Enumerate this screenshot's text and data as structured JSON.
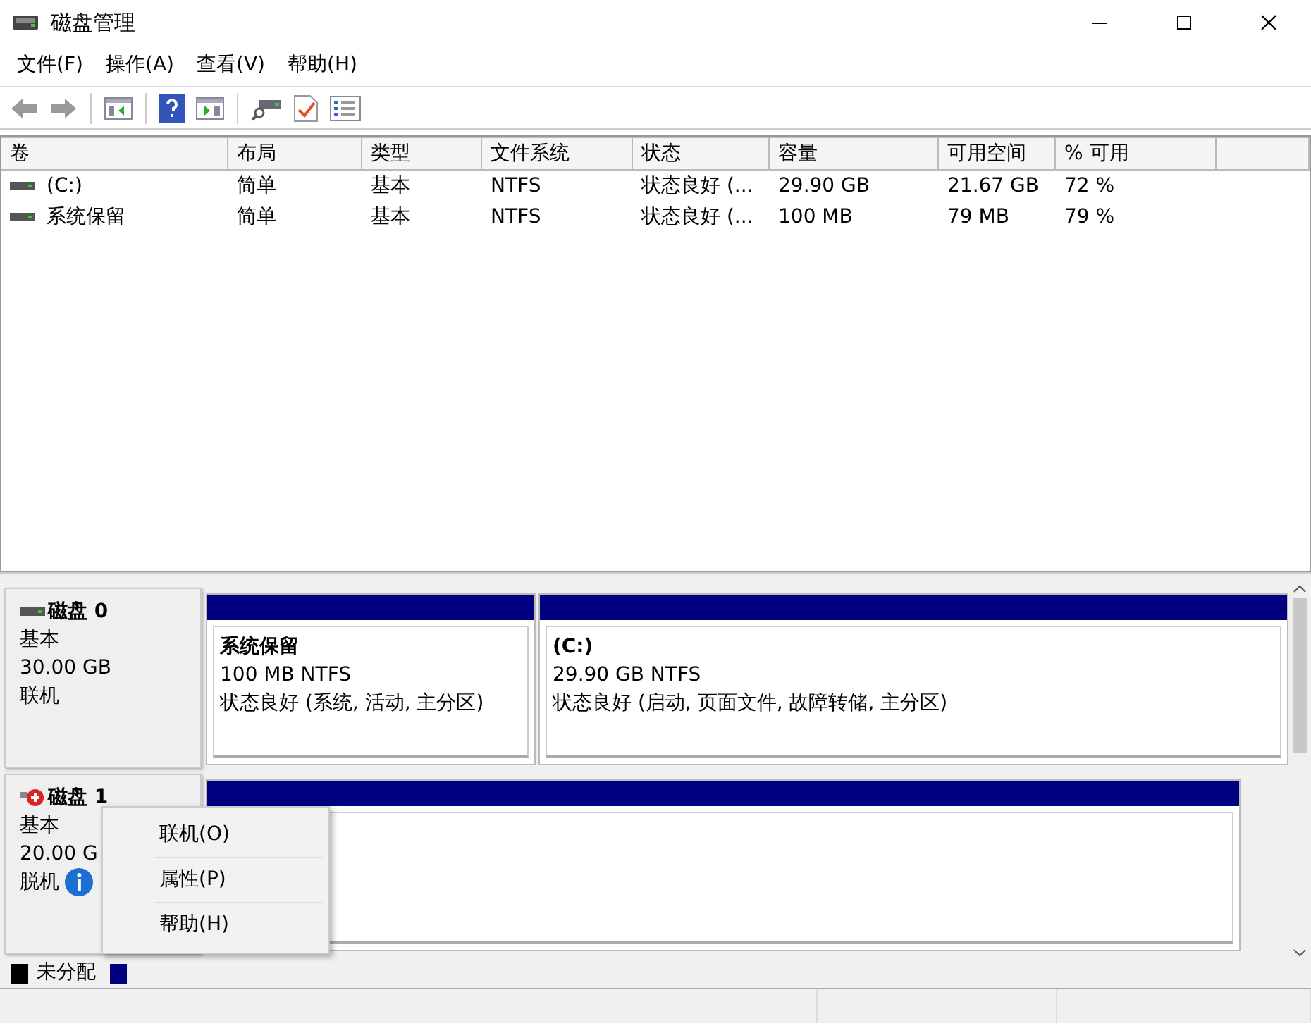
{
  "window": {
    "title": "磁盘管理"
  },
  "menu": [
    "文件(F)",
    "操作(A)",
    "查看(V)",
    "帮助(H)"
  ],
  "volumes": {
    "columns": [
      "卷",
      "布局",
      "类型",
      "文件系统",
      "状态",
      "容量",
      "可用空间",
      "% 可用"
    ],
    "rows": [
      {
        "cells": [
          "(C:)",
          "简单",
          "基本",
          "NTFS",
          "状态良好 (...",
          "29.90 GB",
          "21.67 GB",
          "72 %"
        ]
      },
      {
        "cells": [
          "系统保留",
          "简单",
          "基本",
          "NTFS",
          "状态良好 (...",
          "100 MB",
          "79 MB",
          "79 %"
        ]
      }
    ]
  },
  "disks": [
    {
      "name": "磁盘 0",
      "kind": "online",
      "type": "基本",
      "size": "30.00 GB",
      "status": "联机",
      "partitions": [
        {
          "kind": "volume",
          "name": "系统保留",
          "detail": "100 MB NTFS",
          "status": "状态良好 (系统, 活动, 主分区)"
        },
        {
          "kind": "volume",
          "name": "(C:)",
          "detail": "29.90 GB NTFS",
          "status": "状态良好 (启动, 页面文件, 故障转储, 主分区)"
        }
      ]
    },
    {
      "name": "磁盘 1",
      "kind": "offline",
      "type": "基本",
      "size": "20.00 G",
      "status": "脱机",
      "partitions": [
        {
          "kind": "empty"
        }
      ]
    }
  ],
  "legend": [
    {
      "label": "未分配",
      "color": "#000000"
    },
    {
      "color": "#000080"
    }
  ],
  "context_menu": [
    "联机(O)",
    "属性(P)",
    "帮助(H)"
  ]
}
